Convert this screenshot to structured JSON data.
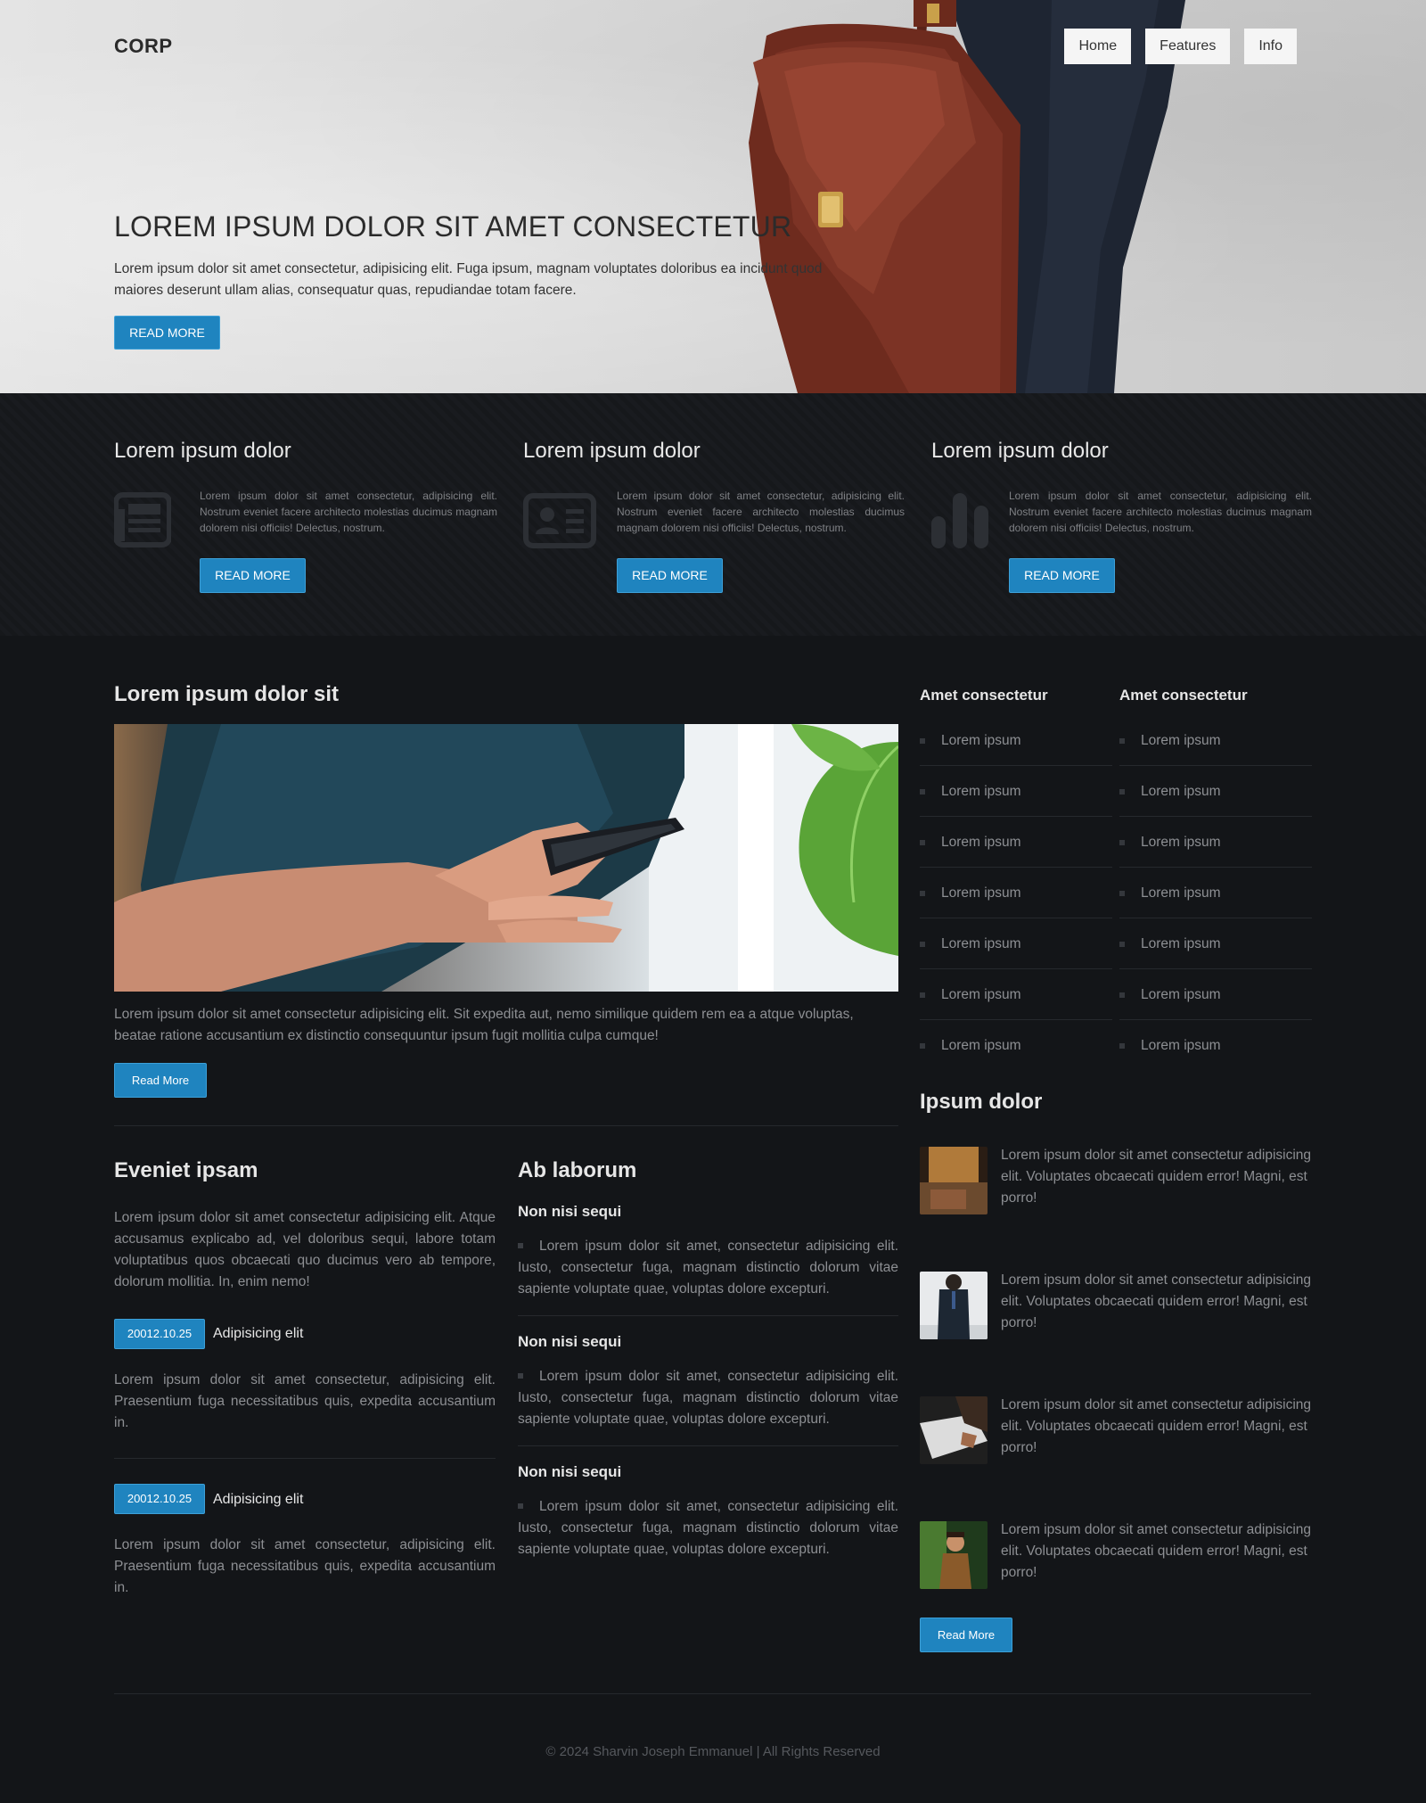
{
  "brand": "CORP",
  "nav": [
    {
      "label": "Home"
    },
    {
      "label": "Features"
    },
    {
      "label": "Info"
    }
  ],
  "hero": {
    "title": "LOREM IPSUM DOLOR SIT AMET CONSECTETUR",
    "text": "Lorem ipsum dolor sit amet consectetur, adipisicing elit. Fuga ipsum, magnam voluptates doloribus ea incidunt quod maiores deserunt ullam alias, consequatur quas, repudiandae totam facere.",
    "button": "READ MORE"
  },
  "features": [
    {
      "title": "Lorem ipsum dolor",
      "icon": "newspaper-icon",
      "text": "Lorem ipsum dolor sit amet consectetur, adipisicing elit. Nostrum eveniet facere architecto molestias ducimus magnam dolorem nisi officiis! Delectus, nostrum.",
      "button": "READ MORE"
    },
    {
      "title": "Lorem ipsum dolor",
      "icon": "id-card-icon",
      "text": "Lorem ipsum dolor sit amet consectetur, adipisicing elit. Nostrum eveniet facere architecto molestias ducimus magnam dolorem nisi officiis! Delectus, nostrum.",
      "button": "READ MORE"
    },
    {
      "title": "Lorem ipsum dolor",
      "icon": "bar-chart-icon",
      "text": "Lorem ipsum dolor sit amet consectetur, adipisicing elit. Nostrum eveniet facere architecto molestias ducimus magnam dolorem nisi officiis! Delectus, nostrum.",
      "button": "READ MORE"
    }
  ],
  "article": {
    "title": "Lorem ipsum dolor sit",
    "image_desc": "person holding smartphone",
    "text": "Lorem ipsum dolor sit amet consectetur adipisicing elit. Sit expedita aut, nemo similique quidem rem ea a atque voluptas, beatae ratione accusantium ex distinctio consequuntur ipsum fugit mollitia culpa cumque!",
    "button": "Read More"
  },
  "eveniet": {
    "title": "Eveniet ipsam",
    "intro": "Lorem ipsum dolor sit amet consectetur adipisicing elit. Atque accusamus explicabo ad, vel doloribus sequi, labore totam voluptatibus quos obcaecati quo ducimus vero ab tempore, dolorum mollitia. In, enim nemo!",
    "posts": [
      {
        "date": "20012.10.25",
        "label": "Adipisicing elit",
        "text": "Lorem ipsum dolor sit amet consectetur, adipisicing elit. Praesentium fuga necessitatibus quis, expedita accusantium in."
      },
      {
        "date": "20012.10.25",
        "label": "Adipisicing elit",
        "text": "Lorem ipsum dolor sit amet consectetur, adipisicing elit. Praesentium fuga necessitatibus quis, expedita accusantium in."
      }
    ]
  },
  "laborum": {
    "title": "Ab laborum",
    "items": [
      {
        "heading": "Non nisi sequi",
        "text": "Lorem ipsum dolor sit amet, consectetur adipisicing elit. Iusto, consectetur fuga, magnam distinctio dolorum vitae sapiente voluptate quae, voluptas dolore excepturi."
      },
      {
        "heading": "Non nisi sequi",
        "text": "Lorem ipsum dolor sit amet, consectetur adipisicing elit. Iusto, consectetur fuga, magnam distinctio dolorum vitae sapiente voluptate quae, voluptas dolore excepturi."
      },
      {
        "heading": "Non nisi sequi",
        "text": "Lorem ipsum dolor sit amet, consectetur adipisicing elit. Iusto, consectetur fuga, magnam distinctio dolorum vitae sapiente voluptate quae, voluptas dolore excepturi."
      }
    ]
  },
  "sidebar": {
    "lists": [
      {
        "title": "Amet consectetur",
        "items": [
          "Lorem ipsum",
          "Lorem ipsum",
          "Lorem ipsum",
          "Lorem ipsum",
          "Lorem ipsum",
          "Lorem ipsum",
          "Lorem ipsum"
        ]
      },
      {
        "title": "Amet consectetur",
        "items": [
          "Lorem ipsum",
          "Lorem ipsum",
          "Lorem ipsum",
          "Lorem ipsum",
          "Lorem ipsum",
          "Lorem ipsum",
          "Lorem ipsum"
        ]
      }
    ],
    "ipsum": {
      "title": "Ipsum dolor",
      "items": [
        {
          "text": "Lorem ipsum dolor sit amet consectetur adipisicing elit. Voluptates obcaecati quidem error! Magni, est porro!"
        },
        {
          "text": "Lorem ipsum dolor sit amet consectetur adipisicing elit. Voluptates obcaecati quidem error! Magni, est porro!"
        },
        {
          "text": "Lorem ipsum dolor sit amet consectetur adipisicing elit. Voluptates obcaecati quidem error! Magni, est porro!"
        },
        {
          "text": "Lorem ipsum dolor sit amet consectetur adipisicing elit. Voluptates obcaecati quidem error! Magni, est porro!"
        }
      ],
      "button": "Read More"
    }
  },
  "footer": "© 2024 Sharvin Joseph Emmanuel | All Rights Reserved",
  "colors": {
    "accent": "#1f84bf",
    "background": "#131518",
    "heading": "#e6e6e6"
  }
}
